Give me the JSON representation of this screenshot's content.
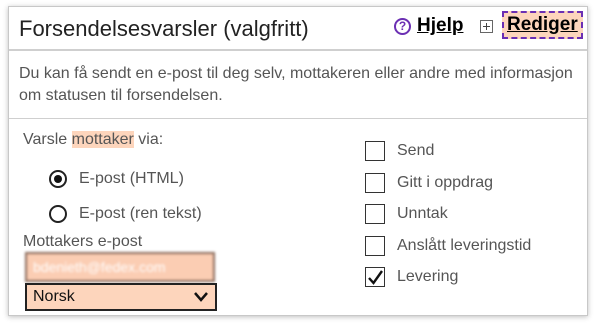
{
  "header": {
    "title": "Forsendelsesvarsler (valgfritt)",
    "help_icon": "?",
    "help_label": "Hjelp",
    "edit_label": "Rediger"
  },
  "description": "Du kan få sendt en e-post til deg selv, mottakeren eller andre med informasjon om statusen til forsendelsen.",
  "notify": {
    "prefix": "Varsle ",
    "highlight": "mottaker",
    "suffix": " via:"
  },
  "format_options": [
    {
      "label": "E-post (HTML)",
      "selected": true
    },
    {
      "label": "E-post (ren tekst)",
      "selected": false
    }
  ],
  "email": {
    "label": "Mottakers e-post",
    "value": "bdenieth@fedex.com"
  },
  "language": {
    "selected": "Norsk"
  },
  "events": [
    {
      "label": "Send",
      "checked": false
    },
    {
      "label": "Gitt i oppdrag",
      "checked": false
    },
    {
      "label": "Unntak",
      "checked": false
    },
    {
      "label": "Anslått leveringstid",
      "checked": false
    },
    {
      "label": "Levering",
      "checked": true
    }
  ],
  "colors": {
    "accent_purple": "#6b2fb3",
    "highlight_peach": "#fdd5bc",
    "border_gray": "#cfcfcf"
  }
}
